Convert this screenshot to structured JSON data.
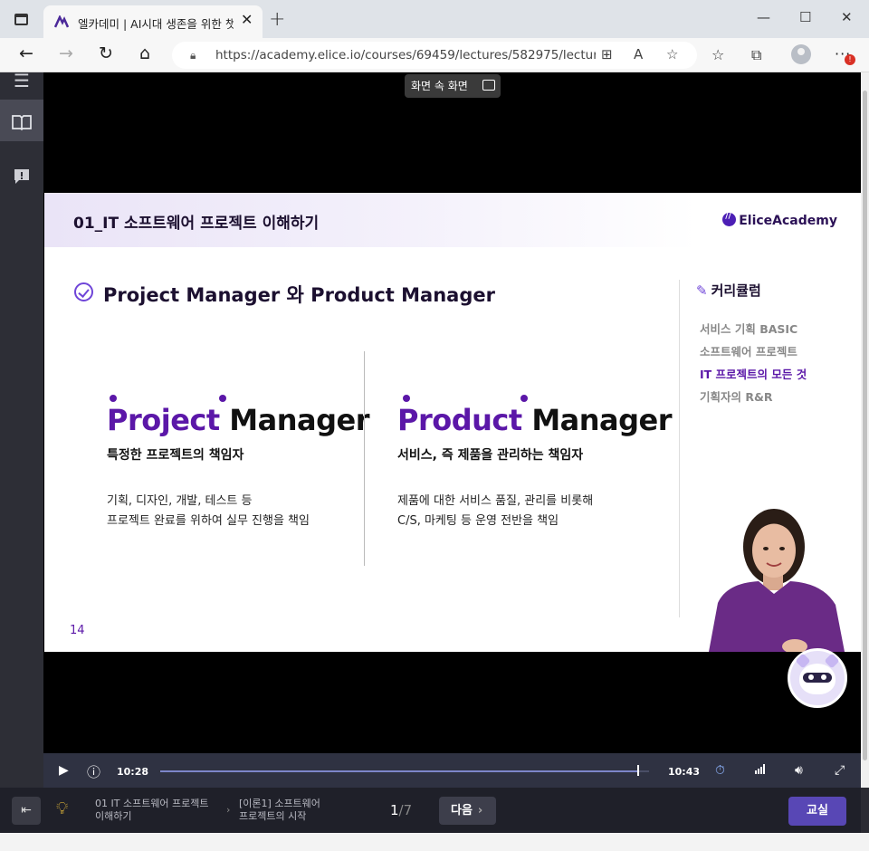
{
  "browser": {
    "tab_title": "엘카데미 | AI시대 생존을 위한 챗",
    "url": "https://academy.elice.io/courses/69459/lectures/582975/lecturep...",
    "pip_tooltip": "화면 속 화면"
  },
  "slide": {
    "header_title": "01_IT 소프트웨어 프로젝트 이해하기",
    "brand": "EliceAcademy",
    "section_title": "Project Manager 와 Product Manager",
    "left": {
      "word1": "Project",
      "word2": "Manager",
      "subtitle": "특정한 프로젝트의 책임자",
      "desc_line1": "기획, 디자인, 개발, 테스트 등",
      "desc_line2": "프로젝트 완료를 위하여 실무 진행을 책임"
    },
    "right": {
      "word1": "Product",
      "word2": "Manager",
      "subtitle": "서비스, 즉 제품을 관리하는 책임자",
      "desc_line1": "제품에 대한 서비스 품질, 관리를 비롯해",
      "desc_line2": "C/S, 마케팅 등 운영 전반을 책임"
    },
    "page_number": "14",
    "curriculum": {
      "title": "커리큘럼",
      "items": [
        "서비스 기획 BASIC",
        "소프트웨어 프로젝트",
        "IT 프로젝트의 모든 것",
        "기획자의 R&R"
      ],
      "active_index": 2
    }
  },
  "player": {
    "current_time": "10:28",
    "duration": "10:43",
    "progress": 0.98
  },
  "footer": {
    "crumb1_line1": "01 IT 소프트웨어 프로젝트",
    "crumb1_line2": "이해하기",
    "crumb2_line1": "[이론1] 소프트웨어",
    "crumb2_line2": "프로젝트의 시작",
    "page_current": "1",
    "page_total": "/7",
    "next_label": "다음",
    "classroom_label": "교실"
  },
  "colors": {
    "accent_purple": "#5b17a8",
    "classroom_button": "#5847b5"
  }
}
